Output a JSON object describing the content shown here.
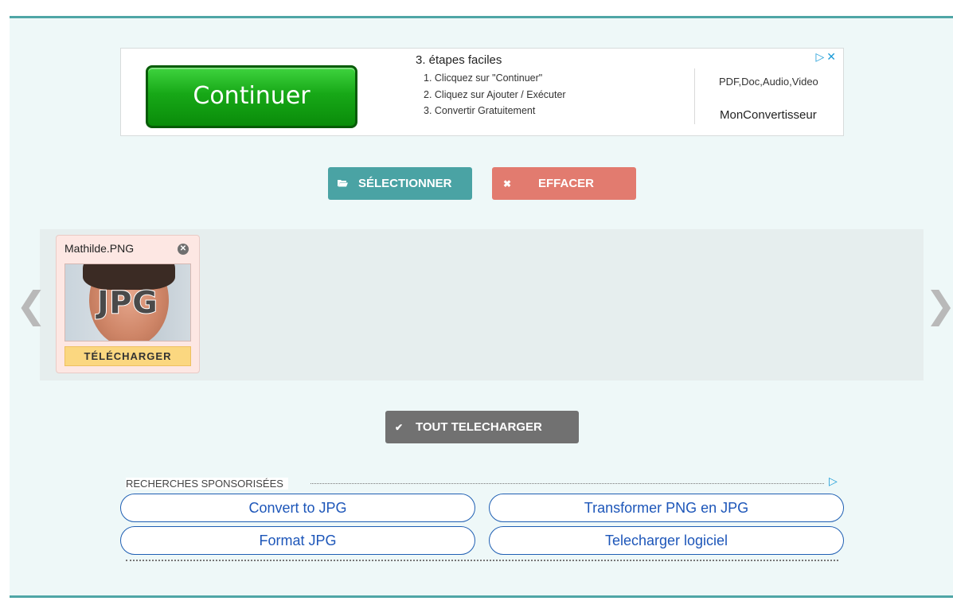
{
  "ad": {
    "button_label": "Continuer",
    "steps_title": "3. étapes faciles",
    "steps": [
      "1. Clicquez sur \"Continuer\"",
      "2. Cliquez sur Ajouter / Exécuter",
      "3. Convertir Gratuitement"
    ],
    "formats": "PDF,Doc,Audio,Video",
    "brand": "MonConvertisseur",
    "choice_icons": "▷✕"
  },
  "toolbar": {
    "select_label": "SÉLECTIONNER",
    "clear_label": "EFFACER"
  },
  "file_card": {
    "filename": "Mathilde.PNG",
    "thumb_overlay": "JPG",
    "download_label": "TÉLÉCHARGER"
  },
  "download_all_label": "TOUT TELECHARGER",
  "sponsored": {
    "title": "RECHERCHES SPONSORISÉES",
    "links": [
      "Convert to JPG",
      "Transformer PNG en JPG",
      "Format JPG",
      "Telecharger logiciel"
    ]
  },
  "nav": {
    "prev": "❮",
    "next": "❯"
  },
  "colors": {
    "accent": "#4aa3a4",
    "danger": "#e27b6f",
    "neutral": "#717171",
    "badge": "#fbd780",
    "link": "#1d56b9"
  }
}
